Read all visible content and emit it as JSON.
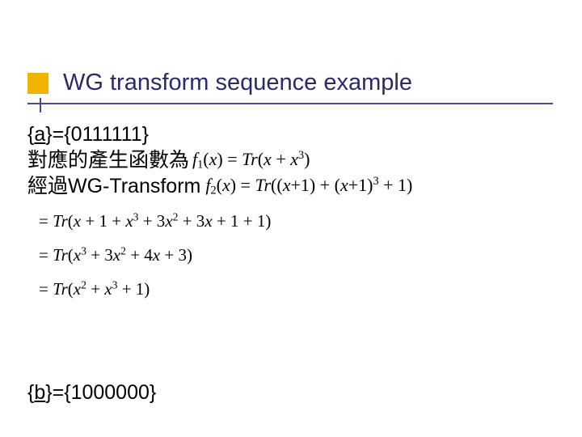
{
  "title": "WG transform sequence example",
  "seq_a": {
    "open": "{",
    "var": "a",
    "rest": "}={0111111}"
  },
  "line2_text": "對應的產生函數為",
  "f1": {
    "eq": "f₁(x) = Tr(x + x³)"
  },
  "line3_text": "經過WG-Transform",
  "f2": {
    "eq": "f₂(x) = Tr((x+1) + (x+1)³ + 1)"
  },
  "deriv": {
    "d1": "= Tr(x + 1 + x³ + 3x² + 3x + 1 + 1)",
    "d2": "= Tr(x³ + 3x² + 4x + 3)",
    "d3": "= Tr(x² + x³ + 1)"
  },
  "seq_b": {
    "open": "{",
    "var": "b",
    "rest": "}={1000000}"
  }
}
